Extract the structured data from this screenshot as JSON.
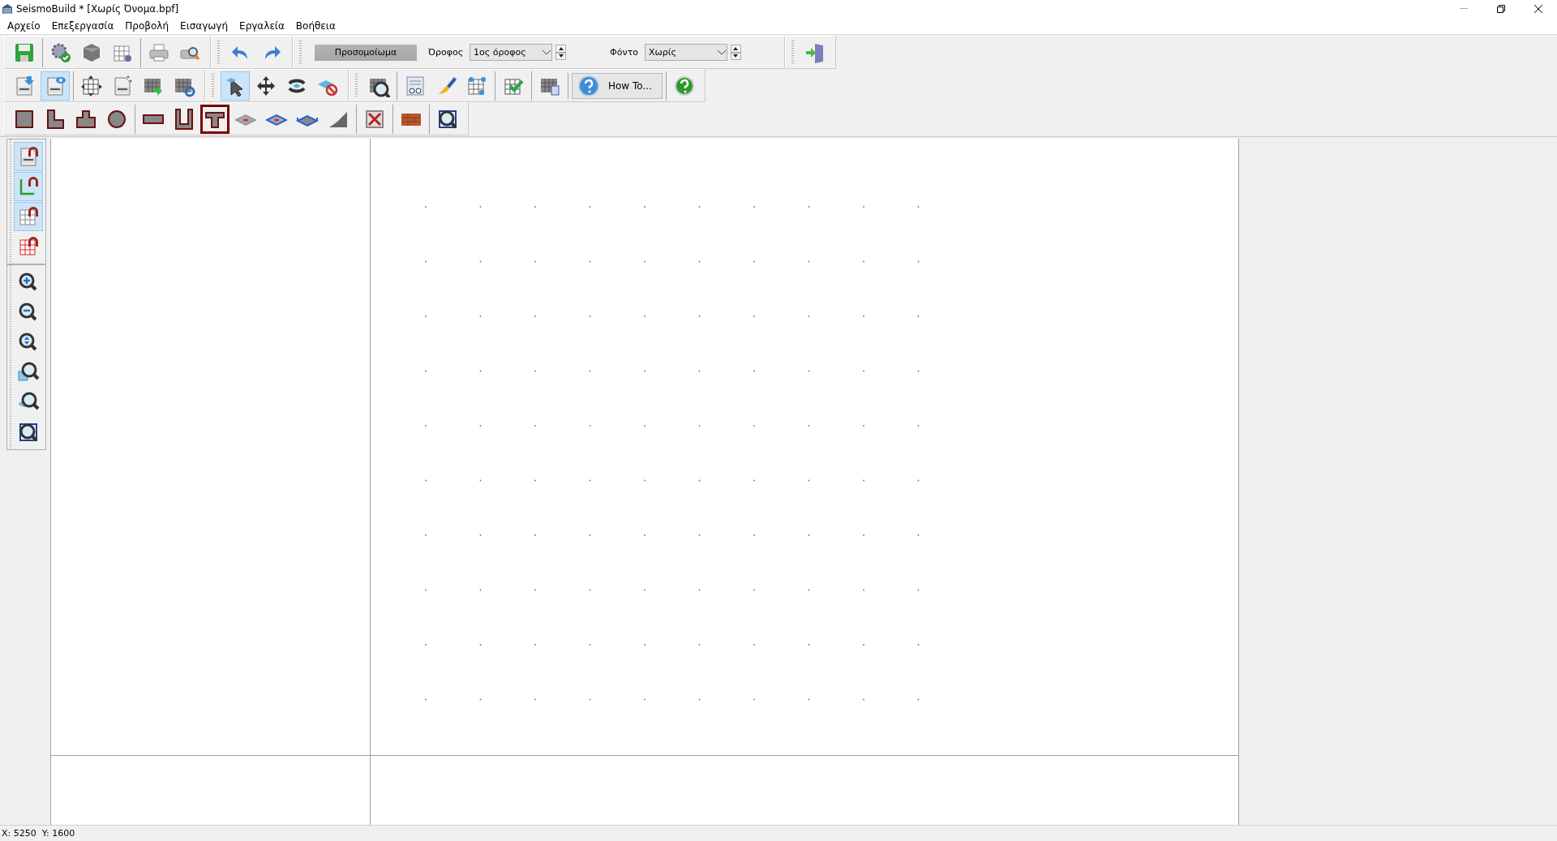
{
  "window": {
    "title": "SeismoBuild * [Χωρίς Όνομα.bpf]"
  },
  "menu": [
    "Αρχείο",
    "Επεξεργασία",
    "Προβολή",
    "Εισαγωγή",
    "Εργαλεία",
    "Βοήθεια"
  ],
  "toolbar_rows": [
    {
      "groups": [
        [
          {
            "kind": "button",
            "selected": false
          }
        ],
        [
          {
            "kind": "button",
            "selected": false
          },
          {
            "kind": "button",
            "selected": false
          },
          {
            "kind": "button",
            "selected": false
          }
        ],
        [
          {
            "kind": "button",
            "selected": false
          },
          {
            "kind": "button",
            "selected": false
          }
        ],
        [
          {
            "kind": "handle"
          },
          {
            "kind": "button",
            "selected": false
          },
          {
            "kind": "button",
            "selected": false
          }
        ],
        [
          {
            "kind": "handle"
          },
          {
            "kind": "wide",
            "label": "Προσομοίωμα"
          },
          {
            "kind": "label",
            "label": "Όροφος"
          },
          {
            "kind": "select",
            "value": "1ος όροφος"
          },
          {
            "kind": "spinner"
          },
          {
            "kind": "label",
            "label": "Φόντο"
          },
          {
            "kind": "select",
            "value": "Χωρίς"
          },
          {
            "kind": "spinner"
          }
        ],
        [
          {
            "kind": "handle"
          },
          {
            "kind": "button",
            "selected": false
          }
        ]
      ]
    },
    {
      "groups": [
        [
          {
            "kind": "button",
            "selected": false
          },
          {
            "kind": "button",
            "selected": true
          }
        ],
        [
          {
            "kind": "button",
            "selected": false
          },
          {
            "kind": "button",
            "selected": false
          },
          {
            "kind": "button",
            "selected": false
          },
          {
            "kind": "button",
            "selected": false
          }
        ],
        [
          {
            "kind": "handle"
          },
          {
            "kind": "button",
            "selected": true
          },
          {
            "kind": "button",
            "selected": false
          },
          {
            "kind": "button",
            "selected": false
          },
          {
            "kind": "button",
            "selected": false
          }
        ],
        [
          {
            "kind": "handle"
          },
          {
            "kind": "button",
            "selected": false
          }
        ],
        [
          {
            "kind": "button",
            "selected": false
          },
          {
            "kind": "button",
            "selected": false
          },
          {
            "kind": "button",
            "selected": false
          }
        ],
        [
          {
            "kind": "button",
            "selected": false
          }
        ],
        [
          {
            "kind": "button",
            "selected": false
          }
        ],
        [
          {
            "kind": "howto",
            "label": "How To..."
          }
        ],
        [
          {
            "kind": "button",
            "selected": false
          }
        ]
      ]
    },
    {
      "groups": [
        [
          {
            "kind": "button",
            "selected": false
          },
          {
            "kind": "button",
            "selected": false
          },
          {
            "kind": "button",
            "selected": false
          },
          {
            "kind": "button",
            "selected": false
          }
        ],
        [
          {
            "kind": "button",
            "selected": false
          },
          {
            "kind": "button",
            "selected": false
          },
          {
            "kind": "button",
            "selected": true
          },
          {
            "kind": "button",
            "selected": false
          },
          {
            "kind": "button",
            "selected": false
          },
          {
            "kind": "button",
            "selected": false
          },
          {
            "kind": "button",
            "selected": false
          }
        ],
        [
          {
            "kind": "button",
            "selected": false
          }
        ],
        [
          {
            "kind": "button",
            "selected": false
          }
        ],
        [
          {
            "kind": "button",
            "selected": false
          }
        ]
      ]
    }
  ],
  "side_toolbars": [
    [
      {
        "selected": true
      },
      {
        "selected": true
      },
      {
        "selected": true
      },
      {
        "selected": false
      }
    ],
    [
      {
        "selected": false
      },
      {
        "selected": false
      },
      {
        "selected": false
      },
      {
        "selected": false
      },
      {
        "selected": false
      },
      {
        "selected": false
      }
    ]
  ],
  "status_bar": {
    "text": "X: 5250  Y: 1600"
  }
}
